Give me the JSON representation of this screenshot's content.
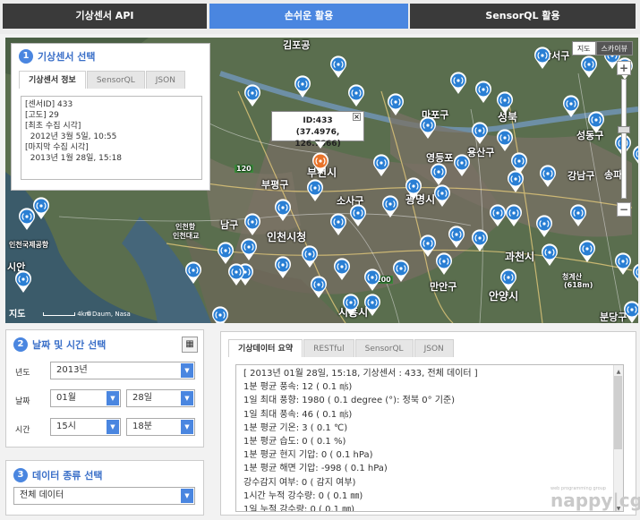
{
  "nav": {
    "tab1": "기상센서 API",
    "tab2": "손쉬운 활용",
    "tab3": "SensorQL 활용"
  },
  "map": {
    "type_map": "지도",
    "type_sky": "스카이뷰",
    "zoom_in": "+",
    "zoom_out": "−",
    "popup_id": "ID:433",
    "popup_coords": "(37.4976, 126.7666)",
    "popup_close": "×",
    "scale": "4km",
    "copyright": "©Daum, Nasa",
    "logo": "지도",
    "labels": {
      "gimpo": "김포공",
      "mapo": "마포구",
      "seongbuk": "성북",
      "yongsan": "용산구",
      "yeongdeungpo": "영등포",
      "bucheon": "부천시",
      "bupyeong": "부평구",
      "sosa": "소사구",
      "gwangmyeong": "광명시",
      "gangnam": "강남구",
      "songpa": "송파",
      "incheon_city": "인천시청",
      "incheon_bridge": "인천대교",
      "incheon_airport": "인천국제공항",
      "namgu": "남구",
      "gwacheon": "과천시",
      "manan": "만안구",
      "anyang": "안양시",
      "cheonggye": "청계산",
      "cheonggye_height": "(618m)",
      "siheung": "시흥시",
      "bundang": "분당구",
      "sinan": "시안",
      "seongdong": "성동구",
      "gangseo": "강서구",
      "incheon_port": "인천항",
      "road_100": "100",
      "road_120": "120"
    }
  },
  "panel1": {
    "badge": "1",
    "title": "기상센서 선택",
    "tab_info": "기상센서 정보",
    "tab_sensorql": "SensorQL",
    "tab_json": "JSON",
    "info": "[센서ID] 433\n[고도] 29\n[최초 수집 시각]\n  2012년 3월 5일, 10:55\n[마지막 수집 시각]\n  2013년 1월 28일, 15:18"
  },
  "panel2": {
    "badge": "2",
    "title": "날짜 및 시간 선택",
    "calendar_icon": "calendar-icon",
    "year_label": "년도",
    "year_value": "2013년",
    "date_label": "날짜",
    "month_value": "01월",
    "day_value": "28일",
    "time_label": "시간",
    "hour_value": "15시",
    "minute_value": "18분"
  },
  "panel3": {
    "badge": "3",
    "title": "데이터 종류 선택",
    "select_value": "전체 데이터"
  },
  "panel4": {
    "tab_summary": "기상데이터 요약",
    "tab_restful": "RESTful",
    "tab_sensorql": "SensorQL",
    "tab_json": "JSON",
    "lines": [
      "[ 2013년 01월 28일, 15:18, 기상센서 : 433,  전체 데이터 ]",
      "1분 평균 풍속: 12 ( 0.1 ㎧)",
      "1일 최대 풍향: 1980 ( 0.1 degree (°): 정북 0° 기준)",
      "1일 최대 풍속: 46 ( 0.1 ㎧)",
      "1분 평균 기온: 3 ( 0.1 ℃)",
      "1분 평균 습도: 0 ( 0.1 %)",
      "1분 평균 현지 기압: 0 ( 0.1 hPa)",
      "1분 평균 해면 기압: -998 ( 0.1 hPa)",
      "강수감지 여부: 0 ( 감지 여부)",
      "1시간 누적 강수량: 0 ( 0.1 ㎜)",
      "1일 누적 강수량: 0 ( 0.1 ㎜)"
    ]
  },
  "footer": {
    "brand": "nappy|cgi",
    "brand_sub": "web programming group"
  },
  "colors": {
    "accent": "#4a86e0",
    "nav_dark": "#3a3a3a",
    "pin_blue": "#2a7fd4",
    "pin_selected": "#e8732a"
  }
}
